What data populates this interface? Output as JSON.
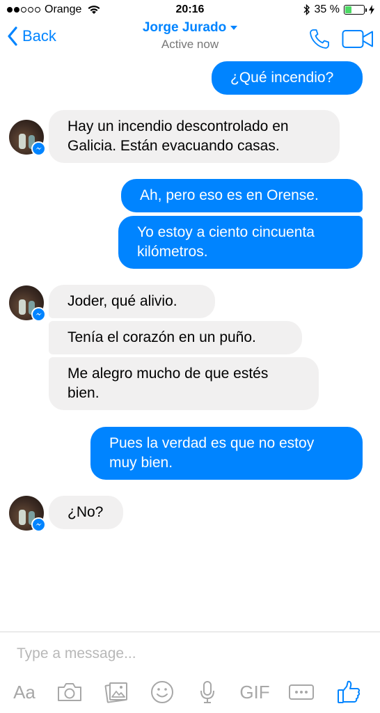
{
  "status_bar": {
    "carrier": "Orange",
    "time": "20:16",
    "battery_percent": "35 %",
    "battery_level": 0.35
  },
  "nav": {
    "back_label": "Back",
    "contact_name": "Jorge Jurado",
    "contact_status": "Active now"
  },
  "messages": [
    {
      "from": "me",
      "text": "¿Qué incendio?"
    },
    {
      "from": "contact",
      "text": "Hay un incendio descontrolado en Galicia. Están evacuando casas."
    },
    {
      "from": "me",
      "text": "Ah, pero eso es en Orense."
    },
    {
      "from": "me",
      "text": "Yo estoy a ciento cincuenta kilómetros."
    },
    {
      "from": "contact",
      "text": "Joder, qué alivio."
    },
    {
      "from": "contact",
      "text": "Tenía el corazón en un puño."
    },
    {
      "from": "contact",
      "text": "Me alegro mucho de que estés bien."
    },
    {
      "from": "me",
      "text": "Pues la verdad es que no estoy muy bien."
    },
    {
      "from": "contact",
      "text": "¿No?"
    }
  ],
  "composer": {
    "placeholder": "Type a message...",
    "text_tool_label": "Aa",
    "gif_label": "GIF"
  },
  "colors": {
    "accent": "#0084ff",
    "incoming_bubble": "#f1f0f0",
    "toolbar_icon": "#a7a7a7"
  }
}
